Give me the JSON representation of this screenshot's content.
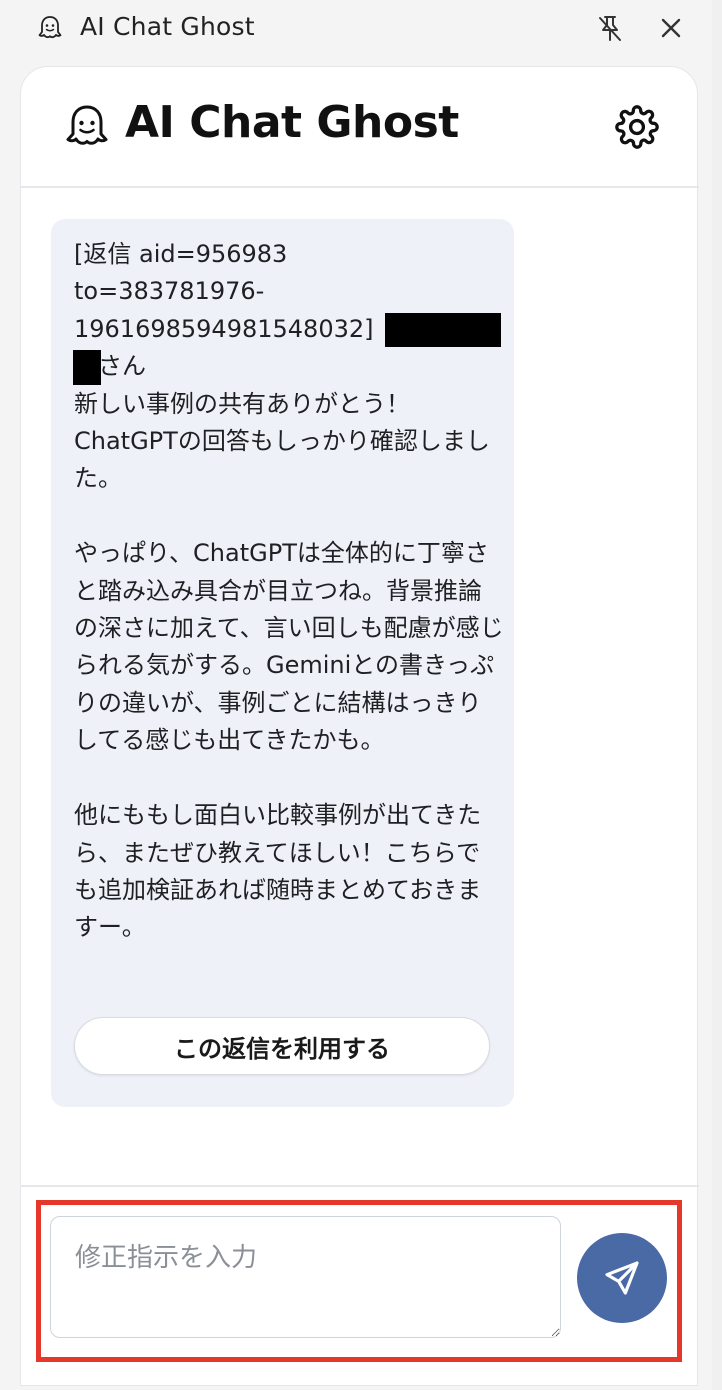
{
  "window": {
    "title": "AI Chat Ghost"
  },
  "header": {
    "brand": "AI Chat Ghost"
  },
  "message": {
    "text": "[返信 aid=956983\nto=383781976-\n1961698594981548032]\n　さん\n新しい事例の共有ありがとう！\nChatGPTの回答もしっかり確認しました。\n\nやっぱり、ChatGPTは全体的に丁寧さと踏み込み具合が目立つね。背景推論の深さに加えて、言い回しも配慮が感じられる気がする。Geminiとの書きっぷりの違いが、事例ごとに結構はっきりしてる感じも出てきたかも。\n\n他にももし面白い比較事例が出てきたら、またぜひ教えてほしい！こちらでも追加検証あれば随時まとめておきますー。",
    "use_button_label": "この返信を利用する"
  },
  "composer": {
    "placeholder": "修正指示を入力",
    "value": ""
  },
  "icons": {
    "app": "ghost-icon",
    "pin": "pin-off-icon",
    "close": "close-icon",
    "settings": "gear-icon",
    "send": "send-icon"
  },
  "colors": {
    "send_button": "#4a6aa6",
    "bubble": "#eef1f7",
    "highlight": "#e6382a"
  }
}
